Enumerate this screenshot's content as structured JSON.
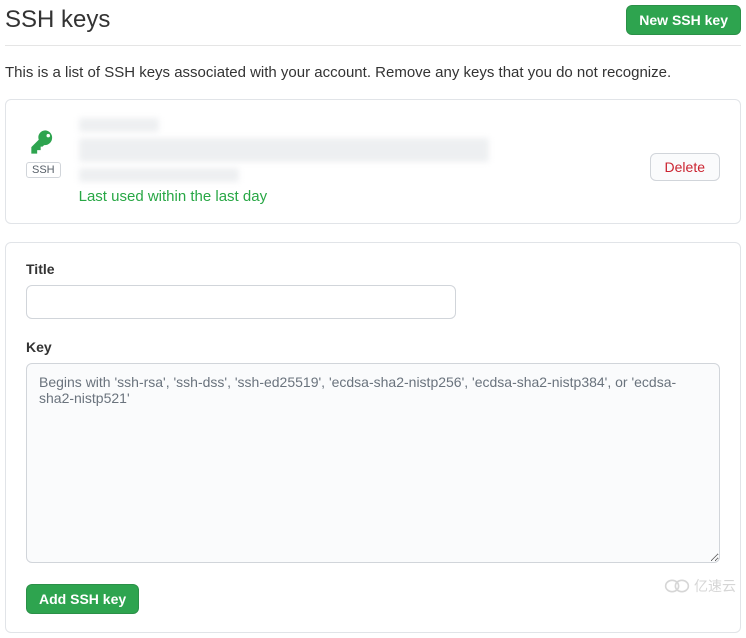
{
  "header": {
    "title": "SSH keys",
    "new_button": "New SSH key"
  },
  "description": "This is a list of SSH keys associated with your account. Remove any keys that you do not recognize.",
  "key_item": {
    "badge": "SSH",
    "last_used": "Last used within the last day",
    "delete_label": "Delete"
  },
  "form": {
    "title_label": "Title",
    "title_value": "",
    "key_label": "Key",
    "key_value": "",
    "key_placeholder": "Begins with 'ssh-rsa', 'ssh-dss', 'ssh-ed25519', 'ecdsa-sha2-nistp256', 'ecdsa-sha2-nistp384', or 'ecdsa-sha2-nistp521'",
    "submit_label": "Add SSH key"
  },
  "watermark": "亿速云"
}
